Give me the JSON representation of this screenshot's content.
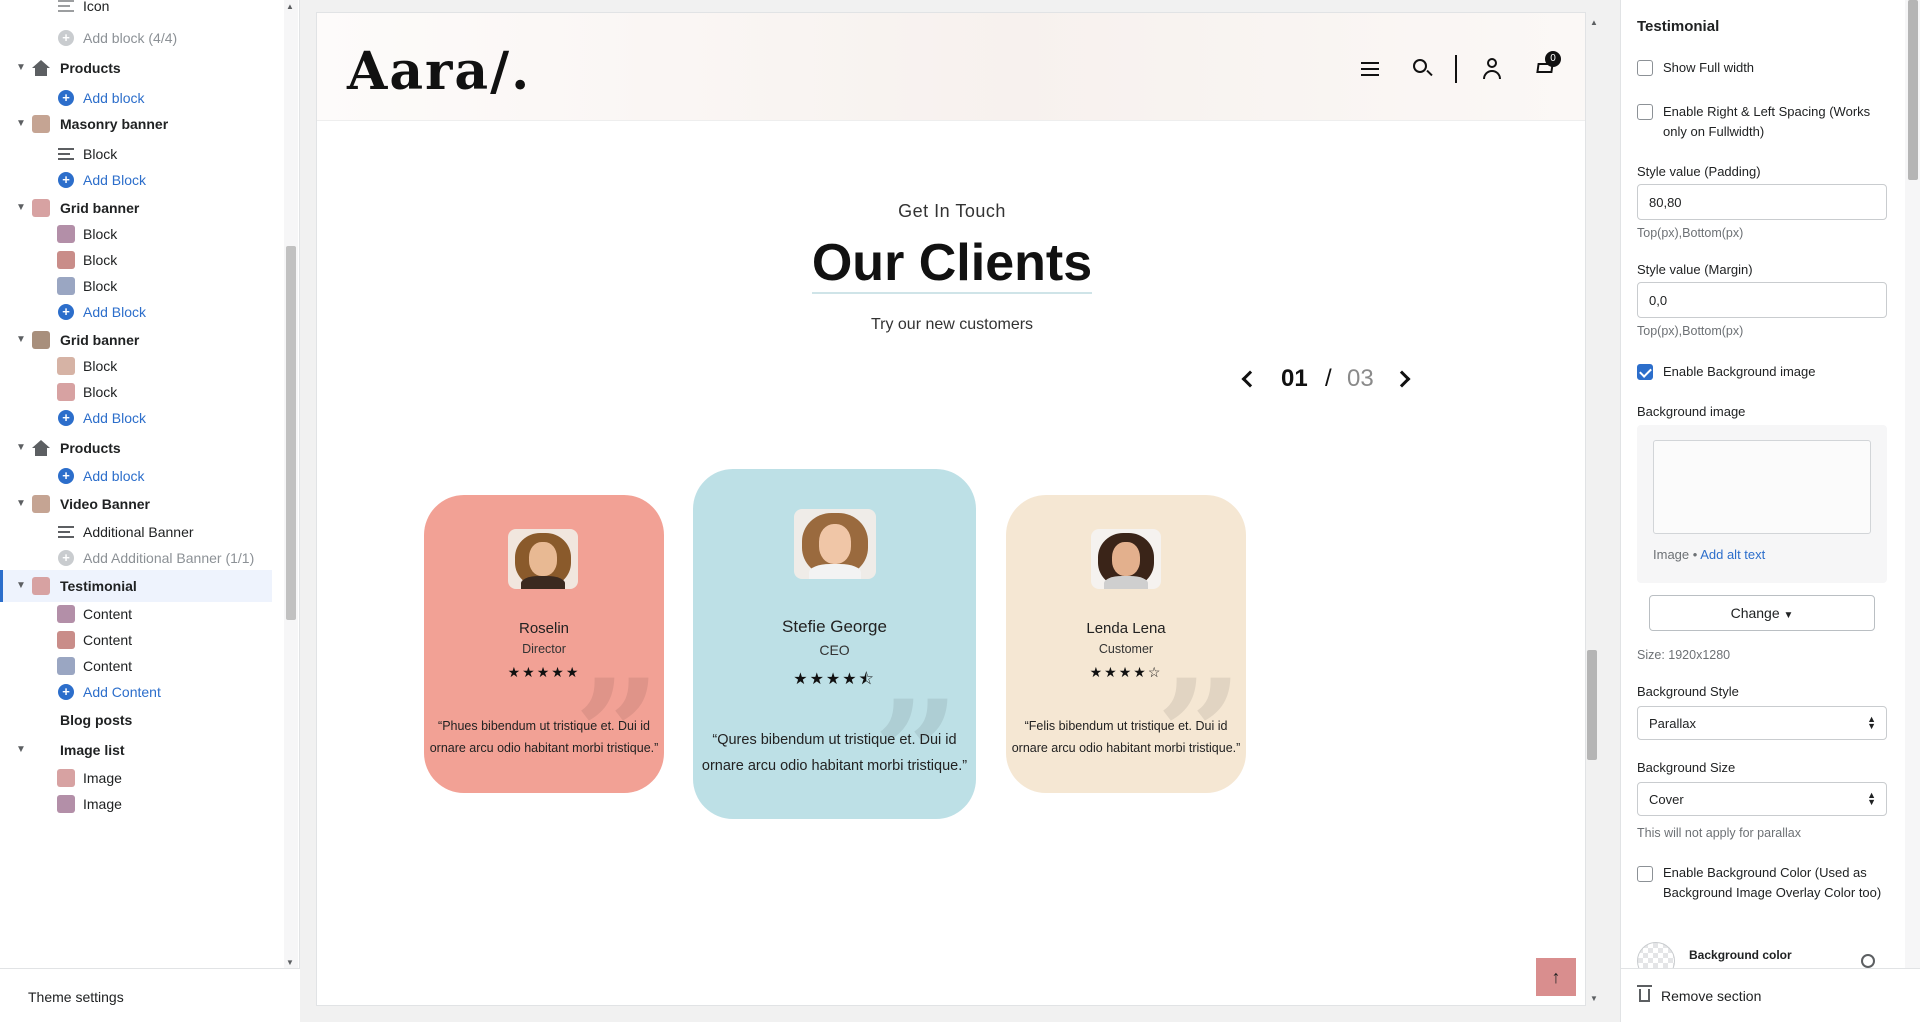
{
  "sidebar": {
    "items": [
      {
        "label": "Icon",
        "level": 2,
        "kind": "block",
        "icon": "cart-icon"
      },
      {
        "label": "Add block (4/4)",
        "level": 2,
        "kind": "add-disabled",
        "icon": "plus-icon"
      },
      {
        "label": "Products",
        "level": 1,
        "kind": "section",
        "icon": "house-icon"
      },
      {
        "label": "Add block",
        "level": 2,
        "kind": "add",
        "icon": "plus-icon"
      },
      {
        "label": "Masonry banner",
        "level": 1,
        "kind": "section",
        "icon": "image-thumb"
      },
      {
        "label": "Block",
        "level": 2,
        "kind": "block",
        "icon": "lines-icon"
      },
      {
        "label": "Add Block",
        "level": 2,
        "kind": "add",
        "icon": "plus-icon"
      },
      {
        "label": "Grid banner",
        "level": 1,
        "kind": "section",
        "icon": "image-thumb"
      },
      {
        "label": "Block",
        "level": 2,
        "kind": "block",
        "icon": "image-thumb"
      },
      {
        "label": "Block",
        "level": 2,
        "kind": "block",
        "icon": "image-thumb"
      },
      {
        "label": "Block",
        "level": 2,
        "kind": "block",
        "icon": "image-thumb"
      },
      {
        "label": "Add Block",
        "level": 2,
        "kind": "add",
        "icon": "plus-icon"
      },
      {
        "label": "Grid banner",
        "level": 1,
        "kind": "section",
        "icon": "image-thumb"
      },
      {
        "label": "Block",
        "level": 2,
        "kind": "block",
        "icon": "image-thumb"
      },
      {
        "label": "Block",
        "level": 2,
        "kind": "block",
        "icon": "image-thumb"
      },
      {
        "label": "Add Block",
        "level": 2,
        "kind": "add",
        "icon": "plus-icon"
      },
      {
        "label": "Products",
        "level": 1,
        "kind": "section",
        "icon": "house-icon"
      },
      {
        "label": "Add block",
        "level": 2,
        "kind": "add",
        "icon": "plus-icon"
      },
      {
        "label": "Video Banner",
        "level": 1,
        "kind": "section",
        "icon": "image-thumb"
      },
      {
        "label": "Additional Banner",
        "level": 2,
        "kind": "block",
        "icon": "lines-icon"
      },
      {
        "label": "Add Additional Banner (1/1)",
        "level": 2,
        "kind": "add-disabled",
        "icon": "plus-icon"
      },
      {
        "label": "Testimonial",
        "level": 1,
        "kind": "section-active",
        "icon": "image-thumb"
      },
      {
        "label": "Content",
        "level": 2,
        "kind": "block",
        "icon": "image-thumb"
      },
      {
        "label": "Content",
        "level": 2,
        "kind": "block",
        "icon": "image-thumb"
      },
      {
        "label": "Content",
        "level": 2,
        "kind": "block",
        "icon": "image-thumb"
      },
      {
        "label": "Add Content",
        "level": 2,
        "kind": "add",
        "icon": "plus-icon"
      },
      {
        "label": "Blog posts",
        "level": 1,
        "kind": "section-plain",
        "icon": ""
      },
      {
        "label": "Image list",
        "level": 1,
        "kind": "section-plain",
        "icon": ""
      },
      {
        "label": "Image",
        "level": 2,
        "kind": "block",
        "icon": "image-thumb"
      },
      {
        "label": "Image",
        "level": 2,
        "kind": "block",
        "icon": "image-thumb"
      }
    ],
    "theme_settings": "Theme settings"
  },
  "preview": {
    "logo": "Aara/.",
    "cart_count": "0",
    "kicker": "Get In Touch",
    "heading": "Our Clients",
    "subheading": "Try our new customers",
    "pager": {
      "current": "01",
      "separator": "/",
      "total": "03"
    },
    "back_to_top": "↑",
    "cards": [
      {
        "name": "Roselin",
        "role": "Director",
        "rating": 5,
        "stars": "★★★★★",
        "quote": "“Phues bibendum ut tristique et. Dui id ornare arcu odio habitant morbi tristique.”",
        "bg": "#f2a195"
      },
      {
        "name": "Stefie George",
        "role": "CEO",
        "rating": 4.5,
        "stars": "★★★★⯪",
        "quote": "“Qures bibendum ut tristique et. Dui id ornare arcu odio habitant morbi tristique.”",
        "bg": "#bde0e6"
      },
      {
        "name": "Lenda Lena",
        "role": "Customer",
        "rating": 4,
        "stars": "★★★★☆",
        "quote": "“Felis bibendum ut tristique et. Dui id ornare arcu odio habitant morbi tristique.”",
        "bg": "#f5e7d3"
      }
    ]
  },
  "panel": {
    "title": "Testimonial",
    "show_full_width": {
      "label": "Show Full width",
      "checked": false
    },
    "enable_spacing": {
      "label": "Enable Right & Left Spacing (Works only on Fullwidth)",
      "checked": false
    },
    "padding": {
      "label": "Style value (Padding)",
      "value": "80,80",
      "help": "Top(px),Bottom(px)"
    },
    "margin": {
      "label": "Style value (Margin)",
      "value": "0,0",
      "help": "Top(px),Bottom(px)"
    },
    "enable_bg_image": {
      "label": "Enable Background image",
      "checked": true
    },
    "bg_image": {
      "label": "Background image",
      "image_text": "Image",
      "alt_link": "Add alt text",
      "change": "Change",
      "size": "Size: 1920x1280"
    },
    "bg_style": {
      "label": "Background Style",
      "value": "Parallax"
    },
    "bg_size": {
      "label": "Background Size",
      "value": "Cover",
      "help": "This will not apply for parallax"
    },
    "enable_bg_color": {
      "label": "Enable Background Color (Used as Background Image Overlay Color too)",
      "checked": false
    },
    "bg_color": {
      "label": "Background color"
    },
    "remove": "Remove section"
  }
}
